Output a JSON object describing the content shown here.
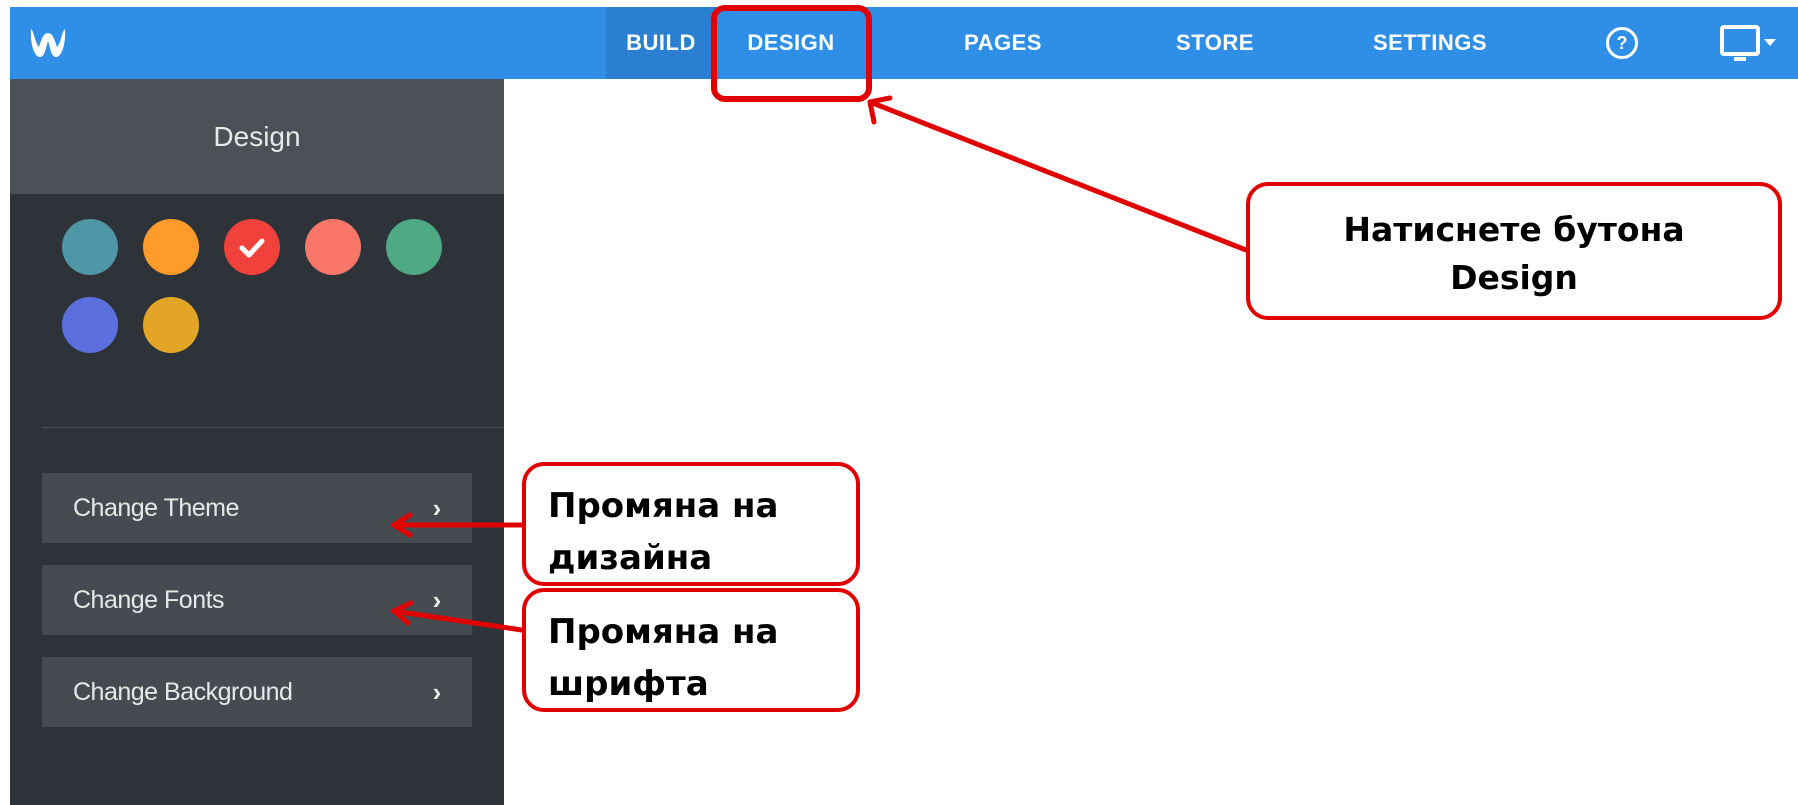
{
  "nav": {
    "build": "BUILD",
    "design": "DESIGN",
    "pages": "PAGES",
    "store": "STORE",
    "settings": "SETTINGS",
    "help": "?"
  },
  "sidebar": {
    "title": "Design",
    "swatches": [
      {
        "color": "#4f97a6",
        "selected": false
      },
      {
        "color": "#ff9b2b",
        "selected": false
      },
      {
        "color": "#f0423b",
        "selected": true
      },
      {
        "color": "#fa7669",
        "selected": false
      },
      {
        "color": "#4daa84",
        "selected": false
      },
      {
        "color": "#5c70dd",
        "selected": false
      },
      {
        "color": "#e3a526",
        "selected": false
      }
    ],
    "buttons": [
      {
        "label": "Change Theme"
      },
      {
        "label": "Change Fonts"
      },
      {
        "label": "Change Background"
      }
    ]
  },
  "annotations": {
    "design_note_line1": "Натиснете бутона",
    "design_note_line2": "Design",
    "theme_note_line1": "Промяна на",
    "theme_note_line2": "дизайна",
    "fonts_note_line1": "Промяна на",
    "fonts_note_line2": "шрифта"
  },
  "colors": {
    "accent": "#2f8fe6",
    "annotation_red": "#e00000"
  }
}
